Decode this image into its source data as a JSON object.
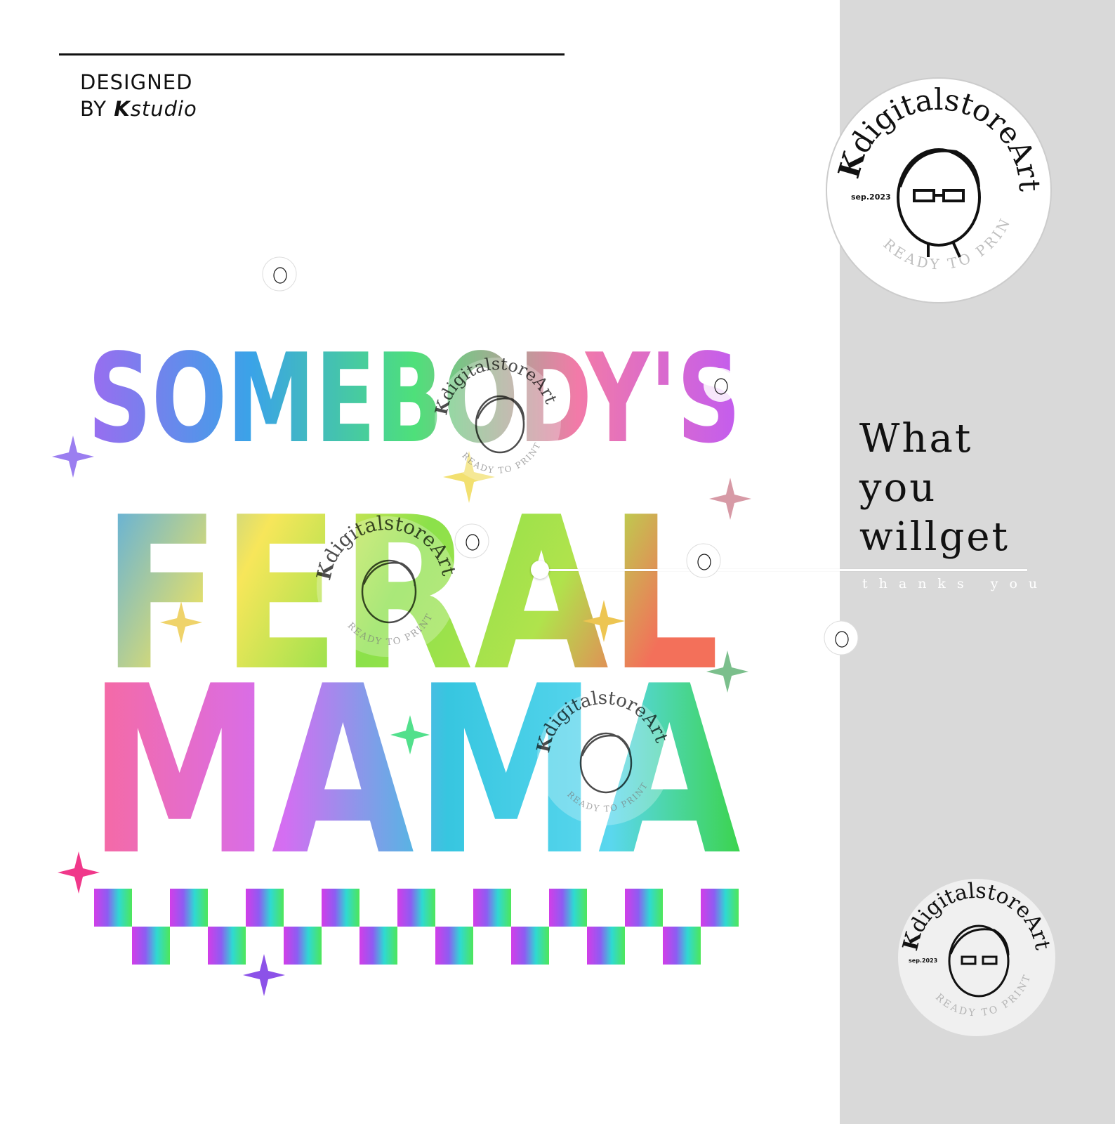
{
  "credit": {
    "line1": "DESIGNED",
    "line2_prefix": "BY ",
    "brand_k": "K",
    "brand_rest": "studio"
  },
  "artwork": {
    "line1": "SOMEBODY'S",
    "line2": "FERAL",
    "line3": "MAMA"
  },
  "headline": {
    "line1": "What",
    "line2": "you",
    "line3": "willget"
  },
  "subtitle": "thanks you",
  "watermark": {
    "brand_k": "K",
    "brand_text": "digitalstoreArt",
    "tagline": "READY TO PRINT",
    "date": "sep.2023"
  },
  "colors": {
    "sidebar": "#d9d9d9",
    "text": "#111111"
  }
}
